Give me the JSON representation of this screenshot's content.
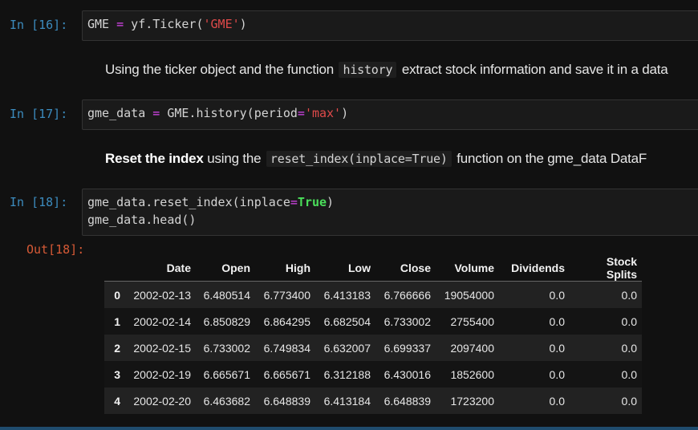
{
  "cells": {
    "c16": {
      "prompt": "In [16]:",
      "tokens": [
        "GME ",
        "=",
        " yf.Ticker(",
        "'GME'",
        ")"
      ]
    },
    "md1": {
      "before": "Using the ticker object and the function",
      "code": "history",
      "after": "extract stock information and save it in a data"
    },
    "c17": {
      "prompt": "In [17]:",
      "tokens": [
        "gme_data ",
        "=",
        " GME.history(period",
        "=",
        "'max'",
        ")"
      ]
    },
    "md2": {
      "bold": "Reset the index",
      "mid": "using the",
      "code": "reset_index(inplace=True)",
      "after": "function on the gme_data DataF"
    },
    "c18": {
      "prompt": "In [18]:",
      "line1_tokens": [
        "gme_data.reset_index(inplace",
        "=",
        "True",
        ")"
      ],
      "line2": "gme_data.head()"
    },
    "out18": {
      "prompt": "Out[18]:"
    }
  },
  "table": {
    "columns": [
      "",
      "Date",
      "Open",
      "High",
      "Low",
      "Close",
      "Volume",
      "Dividends",
      "Stock Splits"
    ],
    "rows": [
      [
        "0",
        "2002-02-13",
        "6.480514",
        "6.773400",
        "6.413183",
        "6.766666",
        "19054000",
        "0.0",
        "0.0"
      ],
      [
        "1",
        "2002-02-14",
        "6.850829",
        "6.864295",
        "6.682504",
        "6.733002",
        "2755400",
        "0.0",
        "0.0"
      ],
      [
        "2",
        "2002-02-15",
        "6.733002",
        "6.749834",
        "6.632007",
        "6.699337",
        "2097400",
        "0.0",
        "0.0"
      ],
      [
        "3",
        "2002-02-19",
        "6.665671",
        "6.665671",
        "6.312188",
        "6.430016",
        "1852600",
        "0.0",
        "0.0"
      ],
      [
        "4",
        "2002-02-20",
        "6.463682",
        "6.648839",
        "6.413184",
        "6.648839",
        "1723200",
        "0.0",
        "0.0"
      ]
    ]
  },
  "colors": {
    "background": "#111111",
    "in_prompt": "#3c8cbf",
    "out_prompt": "#d75a36",
    "operator": "#d946ef",
    "string": "#e04a4a",
    "keyword": "#4ade5a"
  }
}
